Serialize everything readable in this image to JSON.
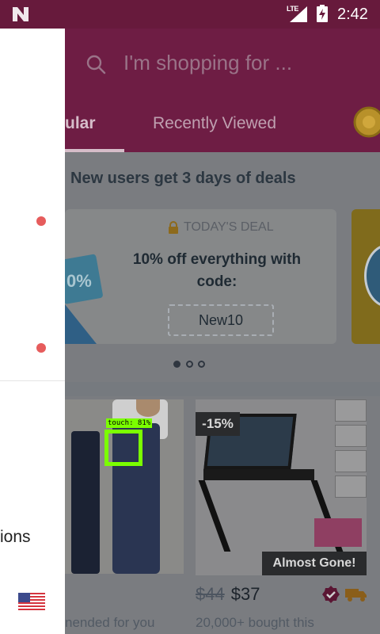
{
  "status_bar": {
    "network": "LTE",
    "time": "2:42"
  },
  "search": {
    "placeholder": "I'm shopping for ..."
  },
  "tabs": [
    {
      "label": "ular",
      "active": true
    },
    {
      "label": "Recently Viewed",
      "active": false
    }
  ],
  "promo": {
    "title": "New users get 3 days of deals",
    "ticket_text": "0%",
    "deal_header": "TODAY'S DEAL",
    "deal_text": "10% off everything with code:",
    "code": "New10",
    "carousel_active_index": 0,
    "carousel_count": 3
  },
  "products": [
    {
      "caption": "nended for you",
      "detection_label": "touch: 81%"
    },
    {
      "discount": "-15%",
      "stock_badge": "Almost Gone!",
      "old_price": "$44",
      "price": "$37",
      "bought": "20,000+ bought this"
    }
  ],
  "drawer": {
    "options_label": "ions"
  },
  "colors": {
    "header": "#6e1d44",
    "status_bar": "#671a3c",
    "drawer_dot": "#e65c5c",
    "detection": "#7bff00"
  }
}
